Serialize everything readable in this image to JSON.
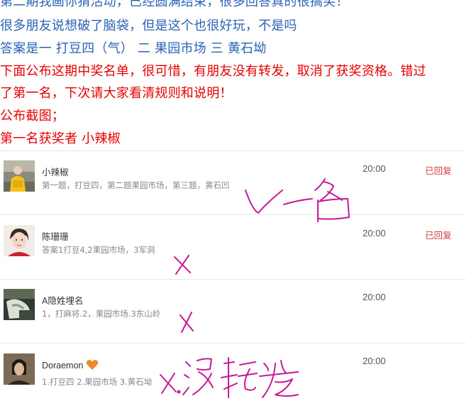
{
  "article": {
    "lines": [
      "第二期我画你猜活动，已经圆满结束，很多回答真的很搞笑！",
      "很多朋友说想破了脑袋，但是这个也很好玩，不是吗",
      "答案是一 打豆四（气） 二 果园市场 三 黄石坳",
      "下面公布这期中奖名单，很可惜，有朋友没有转发，取消了获奖资格。错过",
      "了第一名，下次请大家看清规则和说明！",
      "公布截图；",
      "第一名获奖者 小辣椒"
    ],
    "colors": {
      "blue_text": "#2a62b7",
      "red_text": "#e60000"
    }
  },
  "comments": [
    {
      "nickname": "小辣椒",
      "time": "20:00",
      "status": "已回复",
      "content": "第一题，打豆四，第二题果园市场，第三题，黄石凹",
      "avatar": "avatar-photo"
    },
    {
      "nickname": "陈珊珊",
      "time": "20:00",
      "status": "已回复",
      "content": "答案1打豆4,2果园市场，3军洞",
      "avatar": "avatar-photo"
    },
    {
      "nickname": "A隐姓埋名",
      "time": "20:00",
      "status": "",
      "content": "1，打麻将.2，果园市场.3东山岭",
      "avatar": "avatar-photo"
    },
    {
      "nickname": "Doraemon",
      "time": "20:00",
      "status": "",
      "content": "1.打豆四 2.果园市场 3.黄石坳",
      "avatar": "avatar-photo",
      "badge": "heart-icon"
    }
  ],
  "colors": {
    "reply_status": "#d93a3a",
    "annotation_ink": "#c8189a",
    "heart": "#f08a2c"
  }
}
